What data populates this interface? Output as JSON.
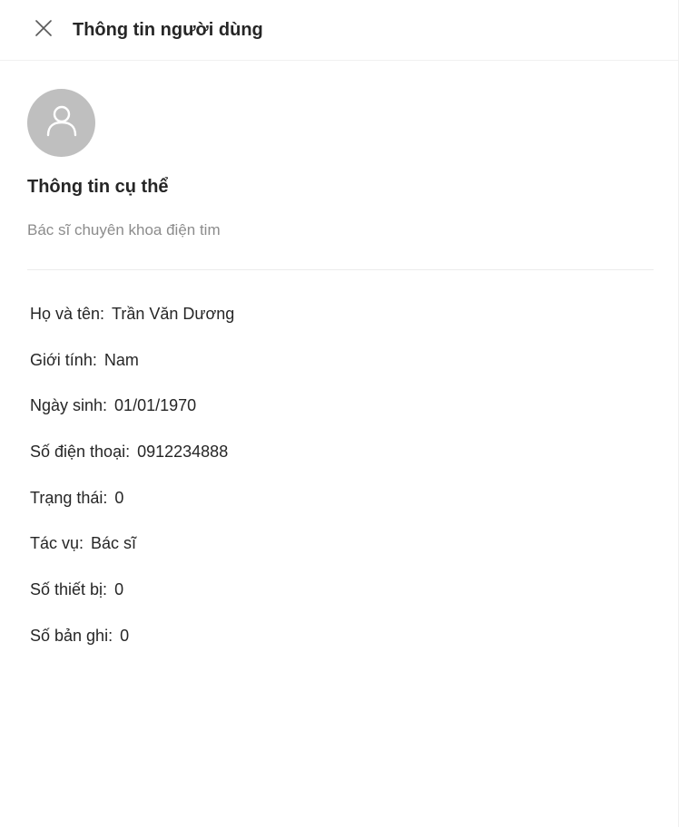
{
  "header": {
    "title": "Thông tin người dùng",
    "close_icon": "close-icon"
  },
  "profile": {
    "avatar_icon": "user-icon",
    "section_title": "Thông tin cụ thể",
    "description": "Bác sĩ chuyên khoa điện tim"
  },
  "fields": [
    {
      "label": "Họ và tên:",
      "value": "Trần Văn Dương"
    },
    {
      "label": "Giới tính:",
      "value": "Nam"
    },
    {
      "label": "Ngày sinh:",
      "value": "01/01/1970"
    },
    {
      "label": "Số điện thoại:",
      "value": "0912234888"
    },
    {
      "label": "Trạng thái:",
      "value": "0"
    },
    {
      "label": "Tác vụ:",
      "value": "Bác sĩ"
    },
    {
      "label": "Số thiết bị:",
      "value": "0"
    },
    {
      "label": "Số bản ghi:",
      "value": "0"
    }
  ],
  "colors": {
    "avatar_bg": "#bfbfbf",
    "muted_text": "#8c8c8c",
    "divider": "#ececec"
  }
}
